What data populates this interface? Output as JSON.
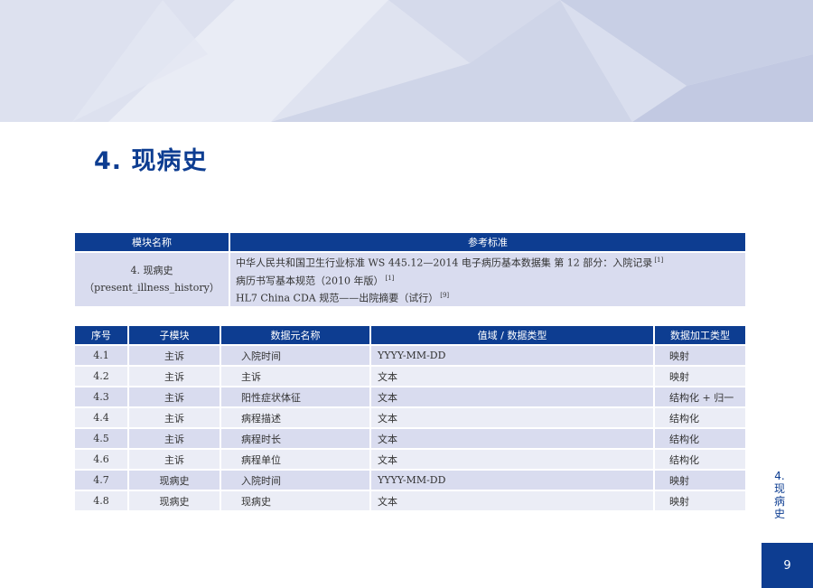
{
  "page": {
    "title": "4. 现病史",
    "side_number": "4.",
    "side_chars": [
      "现",
      "病",
      "史"
    ],
    "page_number": "9"
  },
  "reference_table": {
    "headers": [
      "模块名称",
      "参考标准"
    ],
    "module_name": "4. 现病史",
    "module_id": "（present_illness_history）",
    "references": [
      {
        "text": "中华人民共和国卫生行业标准 WS 445.12—2014 电子病历基本数据集  第 12 部分：入院记录",
        "sup": "[1]"
      },
      {
        "text": "病历书写基本规范（2010 年版）",
        "sup": "[1]"
      },
      {
        "text": "HL7 China CDA 规范——出院摘要（试行）",
        "sup": "[9]"
      }
    ]
  },
  "data_table": {
    "headers": [
      "序号",
      "子模块",
      "数据元名称",
      "值域 / 数据类型",
      "数据加工类型"
    ],
    "rows": [
      [
        "4.1",
        "主诉",
        "入院时间",
        "YYYY-MM-DD",
        "映射"
      ],
      [
        "4.2",
        "主诉",
        "主诉",
        "文本",
        "映射"
      ],
      [
        "4.3",
        "主诉",
        "阳性症状体征",
        "文本",
        "结构化 + 归一"
      ],
      [
        "4.4",
        "主诉",
        "病程描述",
        "文本",
        "结构化"
      ],
      [
        "4.5",
        "主诉",
        "病程时长",
        "文本",
        "结构化"
      ],
      [
        "4.6",
        "主诉",
        "病程单位",
        "文本",
        "结构化"
      ],
      [
        "4.7",
        "现病史",
        "入院时间",
        "YYYY-MM-DD",
        "映射"
      ],
      [
        "4.8",
        "现病史",
        "现病史",
        "文本",
        "映射"
      ]
    ]
  },
  "colors": {
    "primary": "#0d3d91",
    "row_odd": "#d9dcef",
    "row_even": "#ebedf6"
  }
}
